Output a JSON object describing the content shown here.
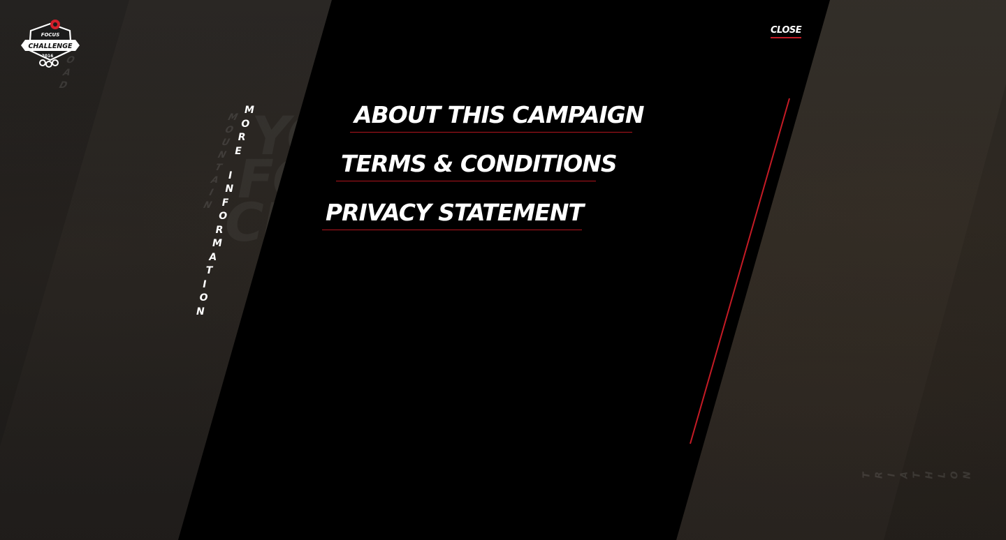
{
  "logo": {
    "brand": "FOCUS",
    "title": "CHALLENGE",
    "year": "2016"
  },
  "header": {
    "close_label": "CLOSE"
  },
  "side_label": {
    "text": "MORE INFORMATION",
    "letters": [
      "M",
      "O",
      "R",
      "E",
      "I",
      "N",
      "F",
      "O",
      "R",
      "M",
      "A",
      "T",
      "I",
      "O",
      "N"
    ]
  },
  "menu": {
    "items": [
      {
        "label": "ABOUT THIS CAMPAIGN"
      },
      {
        "label": "TERMS & CONDITIONS"
      },
      {
        "label": "PRIVACY STATEMENT"
      }
    ]
  },
  "background": {
    "left_vertical_mountain": [
      "M",
      "O",
      "U",
      "N",
      "T",
      "A",
      "I",
      "N"
    ],
    "left_vertical_road": [
      "R",
      "O",
      "A",
      "D"
    ],
    "right_vertical_triathlon": [
      "T",
      "R",
      "I",
      "A",
      "T",
      "H",
      "L",
      "O",
      "N"
    ],
    "ghost_words": [
      "YO",
      "FO",
      "CH"
    ]
  },
  "colors": {
    "accent": "#c51b25",
    "panel": "#000000",
    "text": "#ffffff"
  }
}
